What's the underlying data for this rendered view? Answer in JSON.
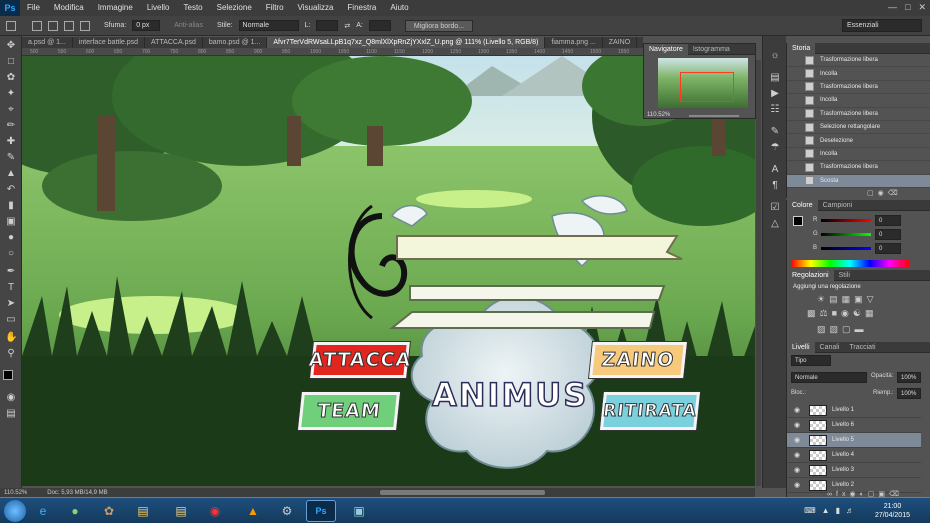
{
  "menubar": {
    "logo": "Ps",
    "items": [
      "File",
      "Modifica",
      "Immagine",
      "Livello",
      "Testo",
      "Selezione",
      "Filtro",
      "Visualizza",
      "Finestra",
      "Aiuto"
    ]
  },
  "options": {
    "sfuma_label": "Sfuma:",
    "sfuma_value": "0 px",
    "antialias": "Anti-alias",
    "stile_label": "Stile:",
    "stile_value": "Normale",
    "l_label": "L:",
    "a_label": "A:",
    "refine_button": "Migliora bordo...",
    "workspace": "Essenziali"
  },
  "doc_tabs": [
    "a.psd @ 1...",
    "interface battle.psd",
    "ATTACCA.psd",
    "bamo.psd @ 1...",
    "Afvr7TerVdRWsaLLpB1q7xz_Q8mlXlXpRnZjYXxlZ_U.png @ 111% (Livello 5, RGB/8)",
    "fiamma.png ...",
    "ZAINO"
  ],
  "ruler": [
    "500",
    "550",
    "600",
    "650",
    "700",
    "750",
    "800",
    "850",
    "900",
    "950",
    "1000",
    "1050",
    "1100",
    "1150",
    "1200",
    "1250",
    "1300",
    "1350",
    "1400",
    "1450",
    "1500",
    "1550"
  ],
  "game": {
    "attack": "ATTACCA",
    "backpack": "ZAINO",
    "team": "TEAM",
    "retreat": "RITIRATA",
    "title": "ANIMUS"
  },
  "status": {
    "zoom": "110.52%",
    "doc": "Doc: 5,93 MB/14,9 MB"
  },
  "navigator": {
    "tab1": "Navigatore",
    "tab2": "Istogramma",
    "zoom": "110.52%"
  },
  "history": {
    "tab": "Storia",
    "items": [
      "Trasformazione libera",
      "Incolla",
      "Trasformazione libera",
      "Incolla",
      "Trasformazione libera",
      "Selezione rettangolare",
      "Deselezione",
      "Incolla",
      "Trasformazione libera",
      "Scosta"
    ]
  },
  "colors": {
    "tab1": "Colore",
    "tab2": "Campioni",
    "r_label": "R",
    "g_label": "G",
    "b_label": "B",
    "r_value": "0",
    "g_value": "0",
    "b_value": "0"
  },
  "adjust": {
    "tab1": "Regolazioni",
    "tab2": "Stili",
    "title": "Aggiungi una regolazione"
  },
  "layers": {
    "tab1": "Livelli",
    "tab2": "Canali",
    "tab3": "Tracciati",
    "kind": "Tipo",
    "blend": "Normale",
    "opacity_label": "Opacità:",
    "opacity_value": "100%",
    "lock_label": "Bloc.:",
    "fill_label": "Riemp.:",
    "fill_value": "100%",
    "items": [
      "Livello 1",
      "Livello 6",
      "Livello 5",
      "Livello 4",
      "Livello 3",
      "Livello 2"
    ],
    "selected": "Livello 5"
  },
  "taskbar": {
    "time": "21:00",
    "date": "27/04/2015"
  }
}
